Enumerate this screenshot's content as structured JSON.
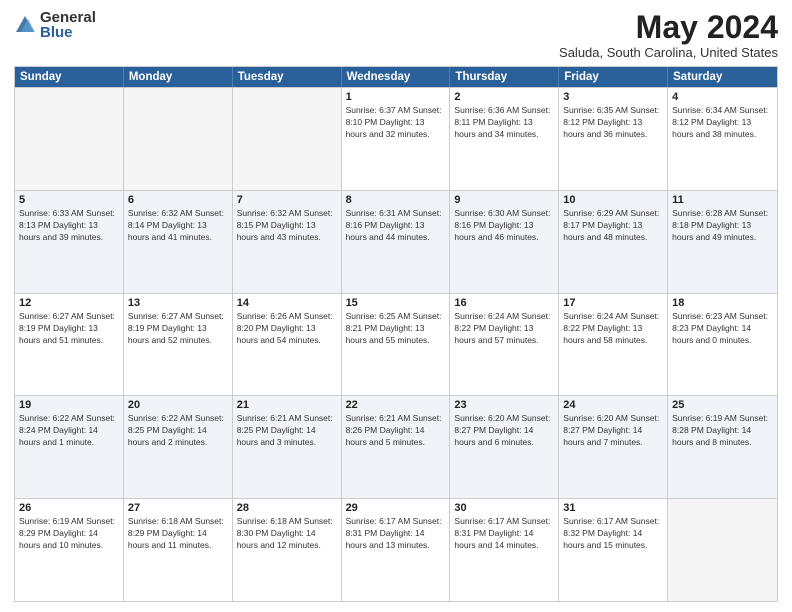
{
  "header": {
    "logo_general": "General",
    "logo_blue": "Blue",
    "month_title": "May 2024",
    "location": "Saluda, South Carolina, United States"
  },
  "calendar": {
    "days_of_week": [
      "Sunday",
      "Monday",
      "Tuesday",
      "Wednesday",
      "Thursday",
      "Friday",
      "Saturday"
    ],
    "rows": [
      [
        {
          "day": "",
          "info": ""
        },
        {
          "day": "",
          "info": ""
        },
        {
          "day": "",
          "info": ""
        },
        {
          "day": "1",
          "info": "Sunrise: 6:37 AM\nSunset: 8:10 PM\nDaylight: 13 hours and 32 minutes."
        },
        {
          "day": "2",
          "info": "Sunrise: 6:36 AM\nSunset: 8:11 PM\nDaylight: 13 hours and 34 minutes."
        },
        {
          "day": "3",
          "info": "Sunrise: 6:35 AM\nSunset: 8:12 PM\nDaylight: 13 hours and 36 minutes."
        },
        {
          "day": "4",
          "info": "Sunrise: 6:34 AM\nSunset: 8:12 PM\nDaylight: 13 hours and 38 minutes."
        }
      ],
      [
        {
          "day": "5",
          "info": "Sunrise: 6:33 AM\nSunset: 8:13 PM\nDaylight: 13 hours and 39 minutes."
        },
        {
          "day": "6",
          "info": "Sunrise: 6:32 AM\nSunset: 8:14 PM\nDaylight: 13 hours and 41 minutes."
        },
        {
          "day": "7",
          "info": "Sunrise: 6:32 AM\nSunset: 8:15 PM\nDaylight: 13 hours and 43 minutes."
        },
        {
          "day": "8",
          "info": "Sunrise: 6:31 AM\nSunset: 8:16 PM\nDaylight: 13 hours and 44 minutes."
        },
        {
          "day": "9",
          "info": "Sunrise: 6:30 AM\nSunset: 8:16 PM\nDaylight: 13 hours and 46 minutes."
        },
        {
          "day": "10",
          "info": "Sunrise: 6:29 AM\nSunset: 8:17 PM\nDaylight: 13 hours and 48 minutes."
        },
        {
          "day": "11",
          "info": "Sunrise: 6:28 AM\nSunset: 8:18 PM\nDaylight: 13 hours and 49 minutes."
        }
      ],
      [
        {
          "day": "12",
          "info": "Sunrise: 6:27 AM\nSunset: 8:19 PM\nDaylight: 13 hours and 51 minutes."
        },
        {
          "day": "13",
          "info": "Sunrise: 6:27 AM\nSunset: 8:19 PM\nDaylight: 13 hours and 52 minutes."
        },
        {
          "day": "14",
          "info": "Sunrise: 6:26 AM\nSunset: 8:20 PM\nDaylight: 13 hours and 54 minutes."
        },
        {
          "day": "15",
          "info": "Sunrise: 6:25 AM\nSunset: 8:21 PM\nDaylight: 13 hours and 55 minutes."
        },
        {
          "day": "16",
          "info": "Sunrise: 6:24 AM\nSunset: 8:22 PM\nDaylight: 13 hours and 57 minutes."
        },
        {
          "day": "17",
          "info": "Sunrise: 6:24 AM\nSunset: 8:22 PM\nDaylight: 13 hours and 58 minutes."
        },
        {
          "day": "18",
          "info": "Sunrise: 6:23 AM\nSunset: 8:23 PM\nDaylight: 14 hours and 0 minutes."
        }
      ],
      [
        {
          "day": "19",
          "info": "Sunrise: 6:22 AM\nSunset: 8:24 PM\nDaylight: 14 hours and 1 minute."
        },
        {
          "day": "20",
          "info": "Sunrise: 6:22 AM\nSunset: 8:25 PM\nDaylight: 14 hours and 2 minutes."
        },
        {
          "day": "21",
          "info": "Sunrise: 6:21 AM\nSunset: 8:25 PM\nDaylight: 14 hours and 3 minutes."
        },
        {
          "day": "22",
          "info": "Sunrise: 6:21 AM\nSunset: 8:26 PM\nDaylight: 14 hours and 5 minutes."
        },
        {
          "day": "23",
          "info": "Sunrise: 6:20 AM\nSunset: 8:27 PM\nDaylight: 14 hours and 6 minutes."
        },
        {
          "day": "24",
          "info": "Sunrise: 6:20 AM\nSunset: 8:27 PM\nDaylight: 14 hours and 7 minutes."
        },
        {
          "day": "25",
          "info": "Sunrise: 6:19 AM\nSunset: 8:28 PM\nDaylight: 14 hours and 8 minutes."
        }
      ],
      [
        {
          "day": "26",
          "info": "Sunrise: 6:19 AM\nSunset: 8:29 PM\nDaylight: 14 hours and 10 minutes."
        },
        {
          "day": "27",
          "info": "Sunrise: 6:18 AM\nSunset: 8:29 PM\nDaylight: 14 hours and 11 minutes."
        },
        {
          "day": "28",
          "info": "Sunrise: 6:18 AM\nSunset: 8:30 PM\nDaylight: 14 hours and 12 minutes."
        },
        {
          "day": "29",
          "info": "Sunrise: 6:17 AM\nSunset: 8:31 PM\nDaylight: 14 hours and 13 minutes."
        },
        {
          "day": "30",
          "info": "Sunrise: 6:17 AM\nSunset: 8:31 PM\nDaylight: 14 hours and 14 minutes."
        },
        {
          "day": "31",
          "info": "Sunrise: 6:17 AM\nSunset: 8:32 PM\nDaylight: 14 hours and 15 minutes."
        },
        {
          "day": "",
          "info": ""
        }
      ]
    ]
  }
}
